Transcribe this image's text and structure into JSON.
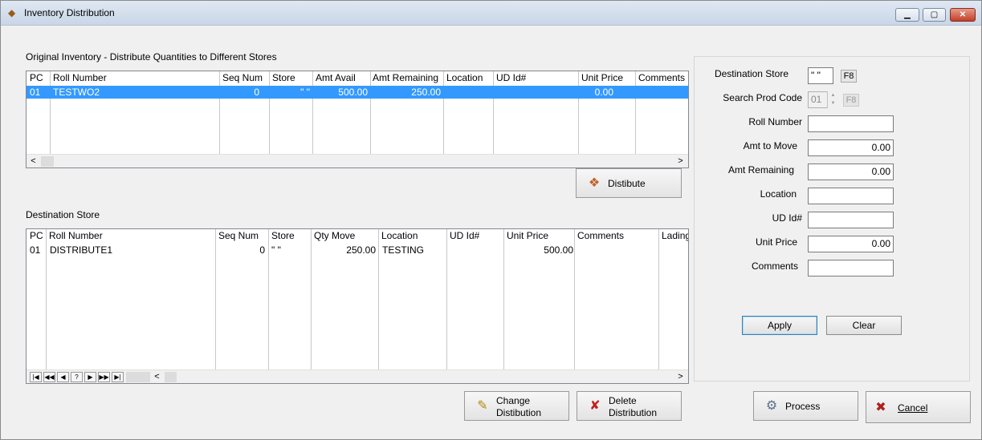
{
  "window": {
    "title": "Inventory Distribution",
    "icon": "app-box-icon",
    "controls": {
      "minimize": "▁",
      "maximize": "▢",
      "close": "✕"
    }
  },
  "original_section": {
    "title": "Original Inventory - Distribute Quantities to Different Stores",
    "columns": [
      "PC",
      "Roll Number",
      "Seq Num",
      "Store",
      "Amt Avail",
      "Amt Remaining",
      "Location",
      "UD Id#",
      "Unit Price",
      "Comments"
    ],
    "rows": [
      {
        "pc": "01",
        "roll_number": "TESTWO2",
        "seq_num": "0",
        "store": "\" \"",
        "amt_avail": "500.00",
        "amt_remaining": "250.00",
        "location": "",
        "ud_id": "",
        "unit_price": "0.00",
        "comments": "",
        "selected": true
      }
    ]
  },
  "distribute_button": {
    "label": "Distibute",
    "icon": "box-distribute-icon"
  },
  "destination_section": {
    "title": "Destination Store",
    "columns": [
      "PC",
      "Roll Number",
      "Seq Num",
      "Store",
      "Qty Move",
      "Location",
      "UD Id#",
      "Unit Price",
      "Comments",
      "Lading"
    ],
    "rows": [
      {
        "pc": "01",
        "roll_number": "DISTRIBUTE1",
        "seq_num": "0",
        "store": "\" \"",
        "qty_move": "250.00",
        "location": "TESTING",
        "ud_id": "",
        "unit_price": "500.00",
        "comments": "",
        "lading": ""
      }
    ],
    "navigator": [
      "|◀",
      "◀◀",
      "◀",
      "?",
      "▶",
      "▶▶",
      "▶|"
    ]
  },
  "bottom_buttons": {
    "change": {
      "line1": "Change",
      "line2": "Distibution",
      "icon": "edit-document-icon"
    },
    "delete": {
      "line1": "Delete",
      "line2": "Distribution",
      "icon": "delete-document-icon"
    },
    "process": {
      "label": "Process",
      "icon": "gears-icon"
    },
    "cancel": {
      "label": "Cancel",
      "icon": "cross-icon"
    }
  },
  "form": {
    "destination_store": {
      "label": "Destination Store",
      "value": "\" \"",
      "key": "F8"
    },
    "search_prod_code": {
      "label": "Search Prod Code",
      "value": "01",
      "key": "F8"
    },
    "roll_number": {
      "label": "Roll Number",
      "value": ""
    },
    "amt_to_move": {
      "label": "Amt to Move",
      "value": "0.00"
    },
    "amt_remaining": {
      "label": "Amt Remaining",
      "value": "0.00"
    },
    "location": {
      "label": "Location",
      "value": ""
    },
    "ud_id": {
      "label": "UD Id#",
      "value": ""
    },
    "unit_price": {
      "label": "Unit Price",
      "value": "0.00"
    },
    "comments": {
      "label": "Comments",
      "value": ""
    },
    "apply_label": "Apply",
    "clear_label": "Clear"
  },
  "scroll": {
    "left": "<",
    "right": ">"
  }
}
